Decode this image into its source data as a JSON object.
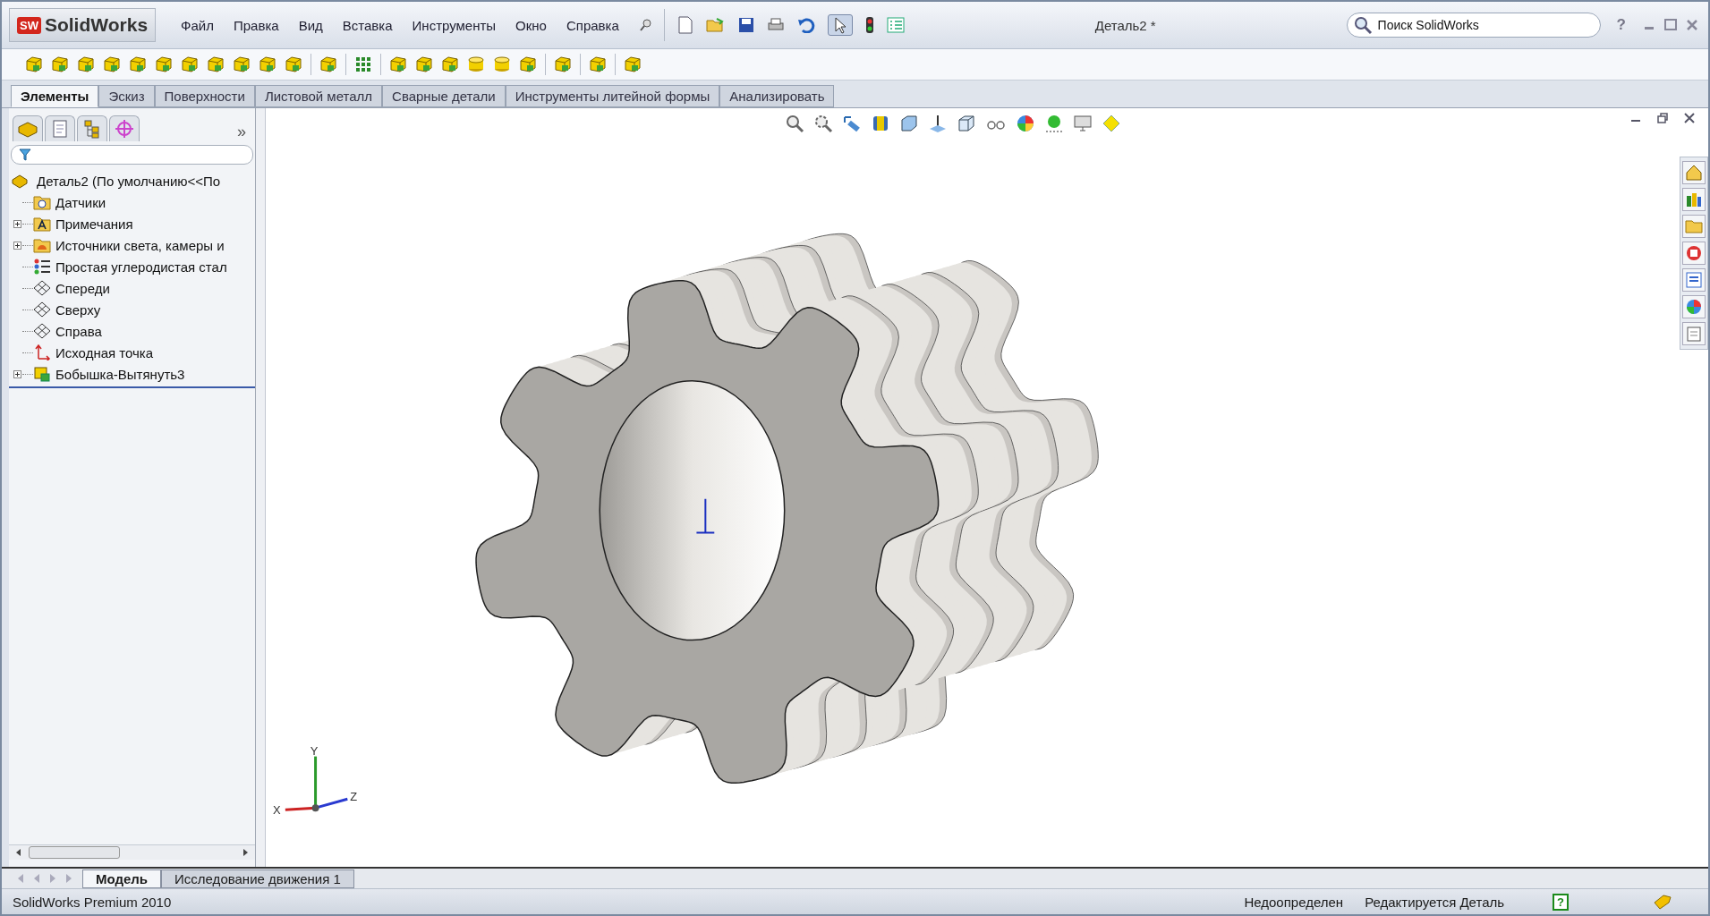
{
  "app": {
    "logo_badge": "SW",
    "logo": "SolidWorks"
  },
  "menu": [
    "Файл",
    "Правка",
    "Вид",
    "Вставка",
    "Инструменты",
    "Окно",
    "Справка"
  ],
  "document_title": "Деталь2 *",
  "search": {
    "placeholder": "Поиск SolidWorks"
  },
  "help_button": "?",
  "command_tabs": [
    {
      "label": "Элементы",
      "selected": true
    },
    {
      "label": "Эскиз",
      "selected": false
    },
    {
      "label": "Поверхности",
      "selected": false
    },
    {
      "label": "Листовой металл",
      "selected": false
    },
    {
      "label": "Сварные детали",
      "selected": false
    },
    {
      "label": "Инструменты литейной формы",
      "selected": false
    },
    {
      "label": "Анализировать",
      "selected": false
    }
  ],
  "feature_tree": {
    "more": "»",
    "root": "Деталь2  (По умолчанию<<По",
    "items": [
      {
        "label": "Датчики",
        "kind": "sensors",
        "expandable": false
      },
      {
        "label": "Примечания",
        "kind": "annotations",
        "expandable": true
      },
      {
        "label": "Источники света, камеры и",
        "kind": "lights",
        "expandable": true
      },
      {
        "label": "Простая углеродистая стал",
        "kind": "material",
        "expandable": false
      },
      {
        "label": "Спереди",
        "kind": "plane",
        "expandable": false
      },
      {
        "label": "Сверху",
        "kind": "plane",
        "expandable": false
      },
      {
        "label": "Справа",
        "kind": "plane",
        "expandable": false
      },
      {
        "label": "Исходная точка",
        "kind": "origin",
        "expandable": false
      },
      {
        "label": "Бобышка-Вытянуть3",
        "kind": "feature",
        "expandable": true
      }
    ]
  },
  "triad": {
    "x": "X",
    "y": "Y",
    "z": "Z"
  },
  "model_tabs": [
    {
      "label": "Модель",
      "selected": true
    },
    {
      "label": "Исследование движения 1",
      "selected": false
    }
  ],
  "status_bar": {
    "product": "SolidWorks Premium 2010",
    "state": "Недоопределен",
    "mode": "Редактируется Деталь",
    "help": "?"
  }
}
